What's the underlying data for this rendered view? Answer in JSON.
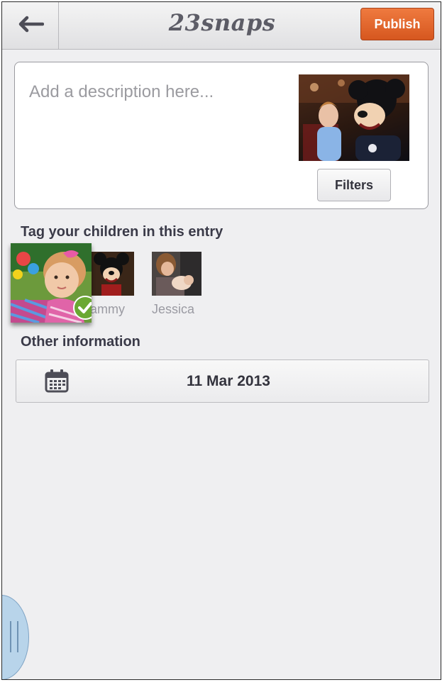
{
  "header": {
    "app_title": "23snaps",
    "publish_label": "Publish"
  },
  "entry": {
    "description_placeholder": "Add a description here...",
    "filters_label": "Filters"
  },
  "tagging": {
    "heading": "Tag your children in this entry",
    "children": [
      {
        "name": "",
        "selected": true
      },
      {
        "name": "Sammy",
        "visible_text": "ammy",
        "selected": false
      },
      {
        "name": "Jessica",
        "selected": false
      }
    ]
  },
  "other": {
    "heading": "Other information",
    "date": "11 Mar 2013"
  },
  "colors": {
    "accent": "#e0642a",
    "check": "#6aa832",
    "background": "#efeff1"
  },
  "icons": [
    "back-arrow-icon",
    "calendar-icon",
    "checkmark-icon"
  ]
}
